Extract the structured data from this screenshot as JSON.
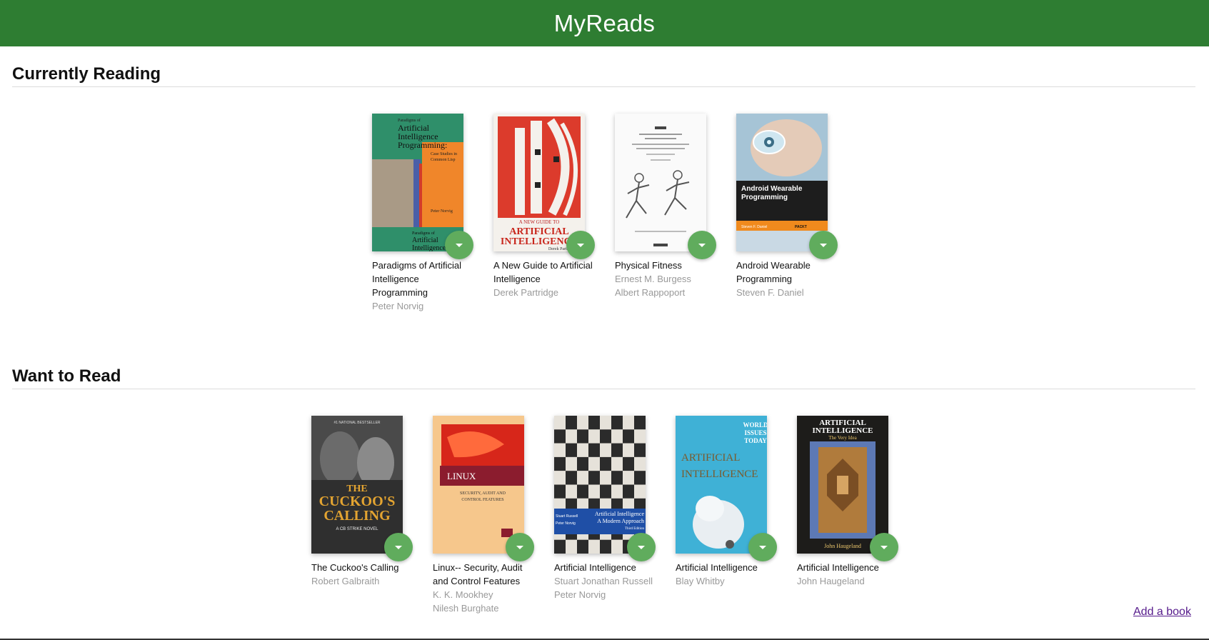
{
  "app": {
    "title": "MyReads"
  },
  "shelves": [
    {
      "title": "Currently Reading",
      "books": [
        {
          "title": "Paradigms of Artificial Intelligence Programming",
          "authors": [
            "Peter Norvig"
          ]
        },
        {
          "title": "A New Guide to Artificial Intelligence",
          "authors": [
            "Derek Partridge"
          ]
        },
        {
          "title": "Physical Fitness",
          "authors": [
            "Ernest M. Burgess",
            "Albert Rappoport"
          ]
        },
        {
          "title": "Android Wearable Programming",
          "authors": [
            "Steven F. Daniel"
          ]
        }
      ]
    },
    {
      "title": "Want to Read",
      "books": [
        {
          "title": "The Cuckoo's Calling",
          "authors": [
            "Robert Galbraith"
          ]
        },
        {
          "title": "Linux-- Security, Audit and Control Features",
          "authors": [
            "K. K. Mookhey",
            "Nilesh Burghate"
          ]
        },
        {
          "title": "Artificial Intelligence",
          "authors": [
            "Stuart Jonathan Russell",
            "Peter Norvig"
          ]
        },
        {
          "title": "Artificial Intelligence",
          "authors": [
            "Blay Whitby"
          ]
        },
        {
          "title": "Artificial Intelligence",
          "authors": [
            "John Haugeland"
          ]
        }
      ]
    }
  ],
  "covers": {
    "paradigms": {
      "lines": [
        "Paradigms of",
        "Artificial",
        "Intelligence",
        "Programming:",
        "Case Studies in",
        "Common Lisp",
        "Peter Norvig",
        "Paradigms of",
        "Artificial",
        "Intelligence"
      ]
    },
    "new_guide": {
      "lines": [
        "A NEW GUIDE TO",
        "ARTIFICIAL",
        "INTELLIGENCE",
        "Derek Partridge"
      ]
    },
    "android": {
      "lines": [
        "Android Wearable",
        "Programming",
        "Steven F. Daniel",
        "PACKT"
      ]
    },
    "cuckoo": {
      "lines": [
        "#1 NATIONAL BESTSELLER",
        "THE",
        "CUCKOO'S",
        "CALLING",
        "A CB STRIKE NOVEL"
      ]
    },
    "linux": {
      "lines": [
        "LINUX",
        "SECURITY, AUDIT AND",
        "CONTROL FEATURES"
      ]
    },
    "russell": {
      "lines": [
        "Stuart Russell",
        "Peter Norvig",
        "Artificial Intelligence",
        "A Modern Approach",
        "Third Edition"
      ]
    },
    "whitby": {
      "lines": [
        "WORLD",
        "ISSUES",
        "TODAY",
        "ARTIFICIAL",
        "INTELLIGENCE"
      ]
    },
    "haugeland": {
      "lines": [
        "ARTIFICIAL",
        "INTELLIGENCE",
        "The Very Idea",
        "John Haugeland"
      ]
    }
  },
  "add_book_label": "Add a book",
  "colors": {
    "header": "#2e7d32",
    "changer": "#60ac5d",
    "author": "#999999"
  },
  "icons": {
    "shelf_changer": "caret-down-icon"
  }
}
